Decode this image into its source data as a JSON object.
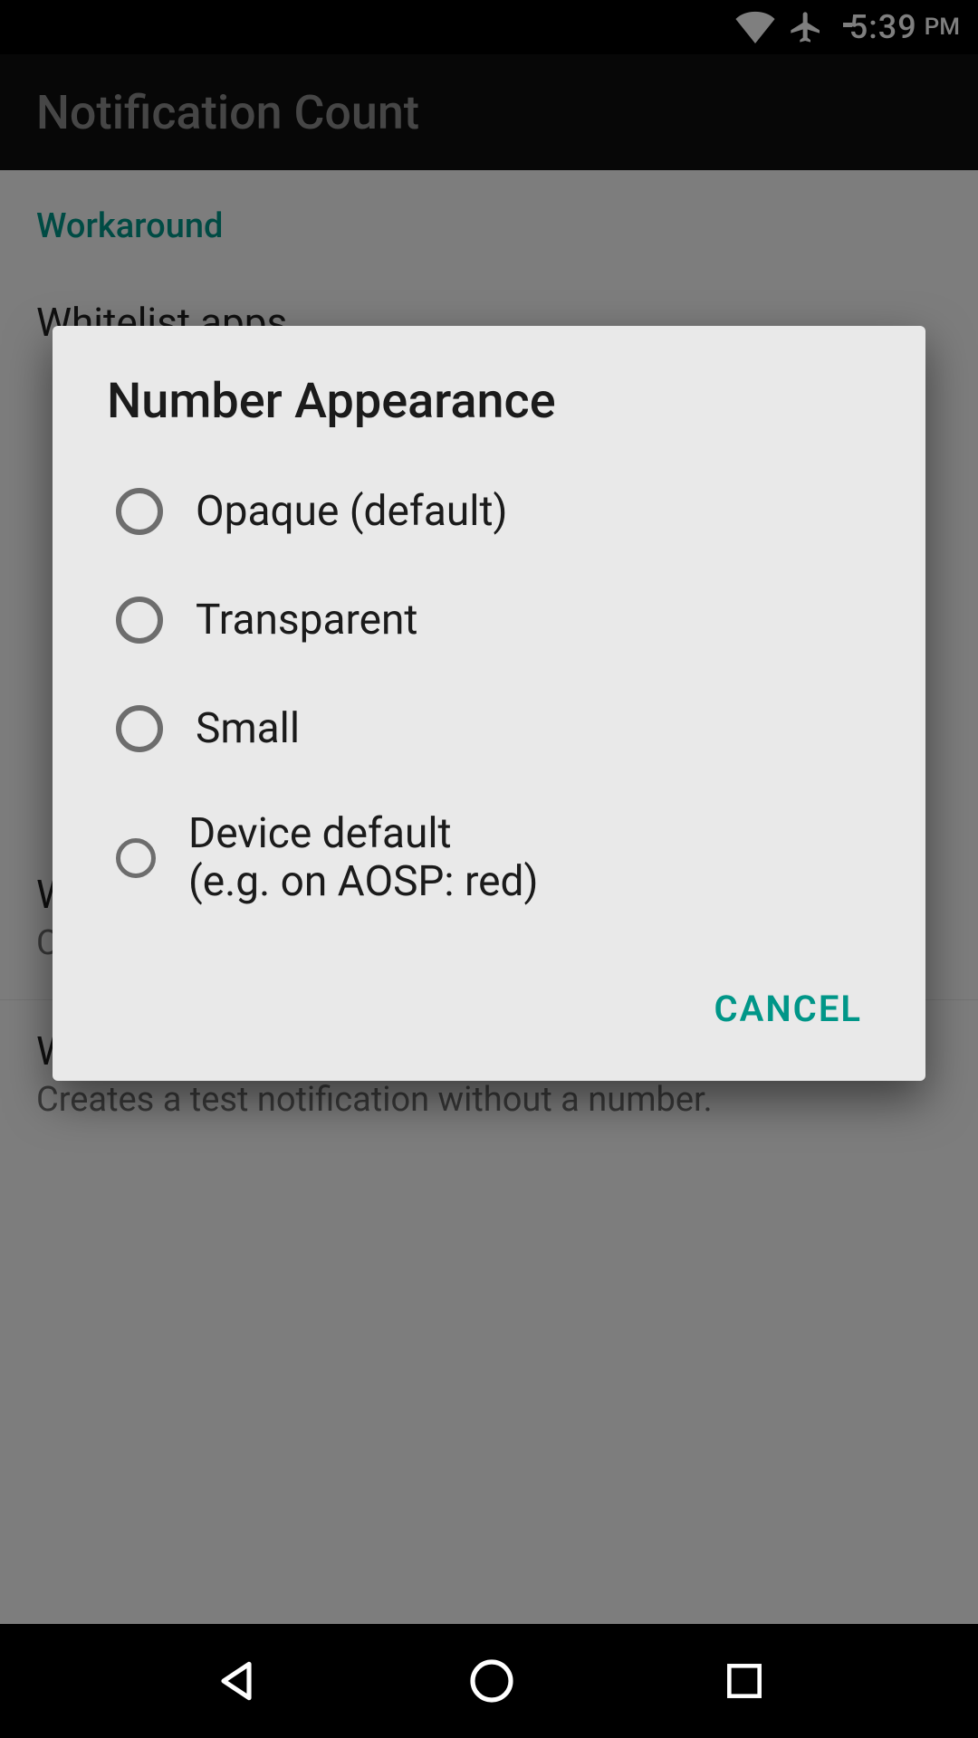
{
  "status": {
    "time": "5:39",
    "ampm": "PM"
  },
  "app_bar": {
    "title": "Notification Count"
  },
  "content": {
    "section_header": "Workaround",
    "whitelist": {
      "title": "Whitelist apps"
    },
    "with_number": {
      "title": "With number",
      "subtitle": "Creates a test notification with a random number."
    },
    "without_number": {
      "title": "Without number",
      "subtitle": "Creates a test notification without a number."
    }
  },
  "dialog": {
    "title": "Number Appearance",
    "options": [
      "Opaque (default)",
      "Transparent",
      "Small",
      "Device default\n(e.g. on AOSP: red)"
    ],
    "cancel": "CANCEL"
  }
}
